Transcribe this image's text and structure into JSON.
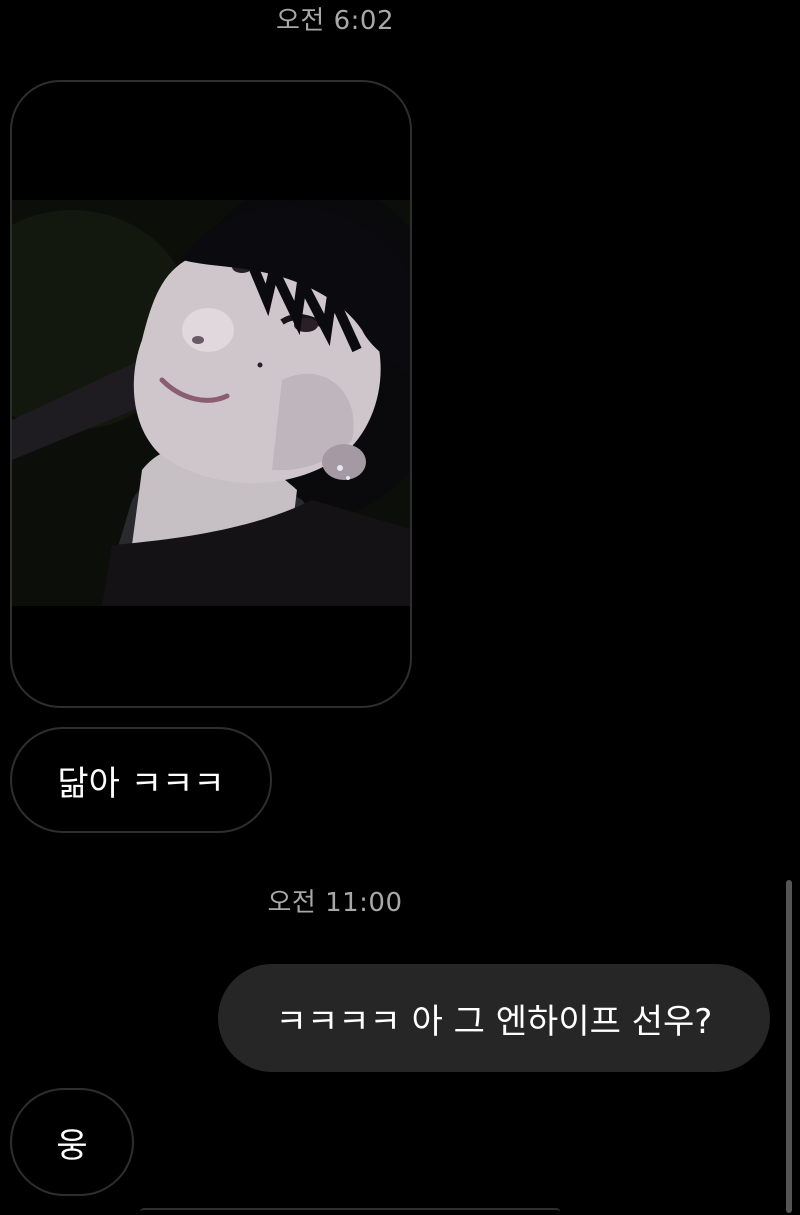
{
  "conversation": {
    "timestamps": [
      "오전 6:02",
      "오전 11:00"
    ],
    "messages": [
      {
        "direction": "incoming",
        "type": "photo",
        "description": "selfie-photo"
      },
      {
        "direction": "incoming",
        "type": "text",
        "text": "닮아 ㅋㅋㅋ"
      },
      {
        "direction": "outgoing",
        "type": "text",
        "text": "ㅋㅋㅋㅋ 아 그 엔하이프 선우?"
      },
      {
        "direction": "incoming",
        "type": "text",
        "text": "웅"
      }
    ]
  },
  "colors": {
    "background": "#000000",
    "incoming_border": "#2e2e2e",
    "outgoing_bubble": "#262626",
    "timestamp_text": "#a8a8a8",
    "message_text": "#ffffff"
  }
}
